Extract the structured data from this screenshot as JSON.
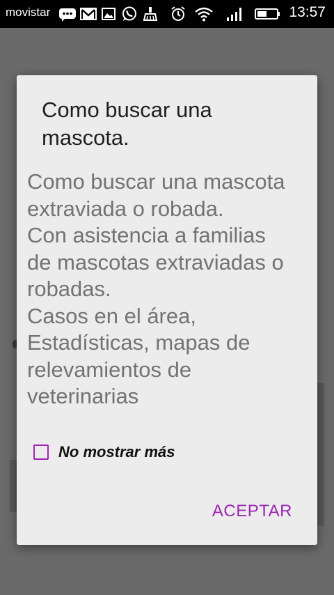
{
  "status_bar": {
    "carrier": "movistar",
    "time": "13:57",
    "icons": [
      "chat-bubble-icon",
      "gmail-icon",
      "gallery-icon",
      "whatsapp-icon",
      "cleaner-icon",
      "alarm-icon",
      "wifi-icon",
      "signal-icon",
      "battery-icon"
    ]
  },
  "dialog": {
    "title_lines": [
      "Como buscar una",
      "mascota."
    ],
    "message_lines": [
      "Como buscar una mascota",
      "extraviada o robada.",
      "Con asistencia a familias",
      "de mascotas extraviadas o",
      "robadas.",
      "Casos en el área,",
      "Estadísticas, mapas de",
      "relevamientos de",
      "veterinarias"
    ],
    "checkbox_label": "No mostrar más",
    "checkbox_checked": false,
    "accept_label": "ACEPTAR"
  },
  "colors": {
    "accent": "#9c27b0",
    "dialog_bg": "#ececec",
    "scrim": "#6b6b6b"
  }
}
